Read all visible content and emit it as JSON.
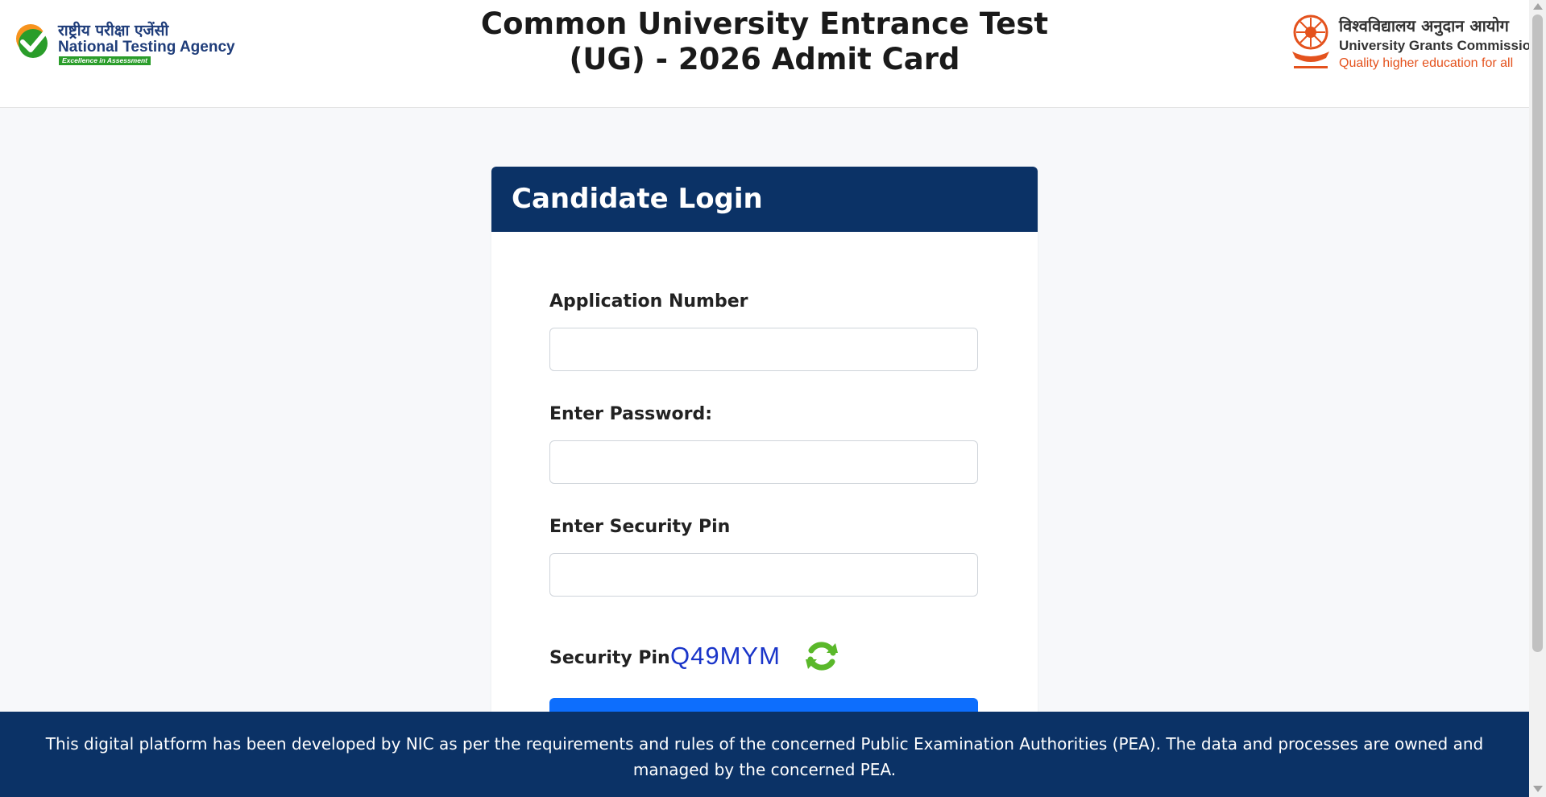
{
  "header": {
    "title": "Common University Entrance Test (UG) - 2026 Admit Card",
    "nta_logo": {
      "hindi": "राष्ट्रीय परीक्षा एजेंसी",
      "name": "National Testing Agency",
      "tagline": "Excellence in Assessment",
      "colors": {
        "orange": "#f7931e",
        "green": "#2a9d2a",
        "navy": "#1f3d7a"
      }
    },
    "ugc_logo": {
      "hindi": "विश्वविद्यालय अनुदान आयोग",
      "name": "University Grants Commission",
      "tagline": "Quality higher education for all",
      "colors": {
        "accent": "#e4521d"
      }
    }
  },
  "login": {
    "heading": "Candidate Login",
    "application_number_label": "Application Number",
    "application_number_value": "",
    "password_label": "Enter Password:",
    "password_value": "",
    "security_pin_input_label": "Enter Security Pin",
    "security_pin_value": "",
    "captcha_label": "Security Pin",
    "captcha_code": "Q49MYM",
    "submit_label": "",
    "refresh_icon": "refresh-icon"
  },
  "footer": {
    "text": "This digital platform has been developed by NIC as per the requirements and rules of the concerned Public Examination Authorities (PEA). The data and processes are owned and managed by the concerned PEA."
  },
  "theme": {
    "primary_navy": "#0b3266",
    "button_blue": "#0d6efd",
    "page_background": "#f7f8fa"
  }
}
